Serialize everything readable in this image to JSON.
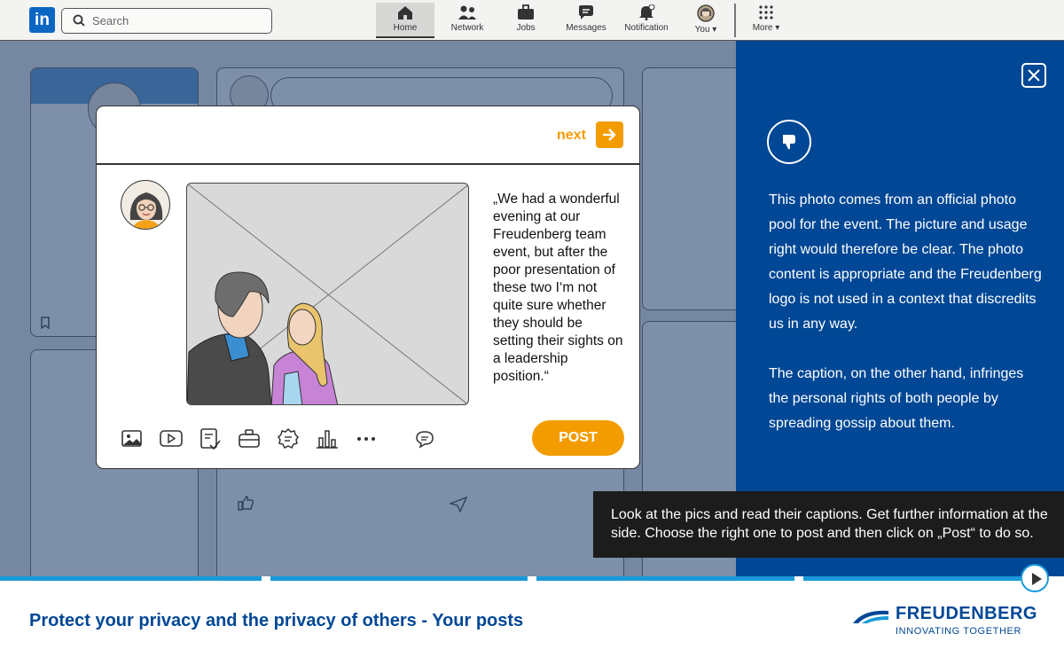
{
  "topbar": {
    "logo": "in",
    "search_placeholder": "Search",
    "nav": [
      {
        "label": "Home",
        "icon": "home-icon"
      },
      {
        "label": "Network",
        "icon": "network-icon"
      },
      {
        "label": "Jobs",
        "icon": "briefcase-icon"
      },
      {
        "label": "Messages",
        "icon": "messages-icon"
      },
      {
        "label": "Notification",
        "icon": "bell-icon"
      },
      {
        "label": "You",
        "icon": "avatar-icon"
      },
      {
        "label": "More",
        "icon": "grid-icon"
      }
    ]
  },
  "dialog": {
    "next_label": "next",
    "caption": "„We had a wonderful evening at our Freudenberg team event, but after the poor presentation of these two I‘m not quite sure whether they should be setting their sights on a leadership position.“",
    "post_label": "POST",
    "tools": [
      "image-icon",
      "video-icon",
      "document-icon",
      "briefcase-icon",
      "badge-icon",
      "poll-icon",
      "more-icon",
      "comment-icon"
    ]
  },
  "panel": {
    "paragraph_1": "This photo comes from an official photo pool for the event. The picture and usage right would therefore be clear. The photo content is appropriate and the Freudenberg logo is not used in a context that discredits us in any way.",
    "paragraph_2": "The caption, on the other hand, infringes the personal rights of both people by spreading gossip about them."
  },
  "instruction": "Look at the pics and read their captions. Get further information at the side. Choose the right one to post and then click on „Post“ to do so.",
  "footer": {
    "title": "Protect your privacy and the privacy of others - Your posts",
    "brand_name": "FREUDENBERG",
    "brand_tagline": "INNOVATING TOGETHER"
  },
  "progress": {
    "segments": 4,
    "completed": 3
  },
  "colors": {
    "accent": "#f39c00",
    "brand_blue": "#004795",
    "progress_blue": "#1a9ad9"
  }
}
